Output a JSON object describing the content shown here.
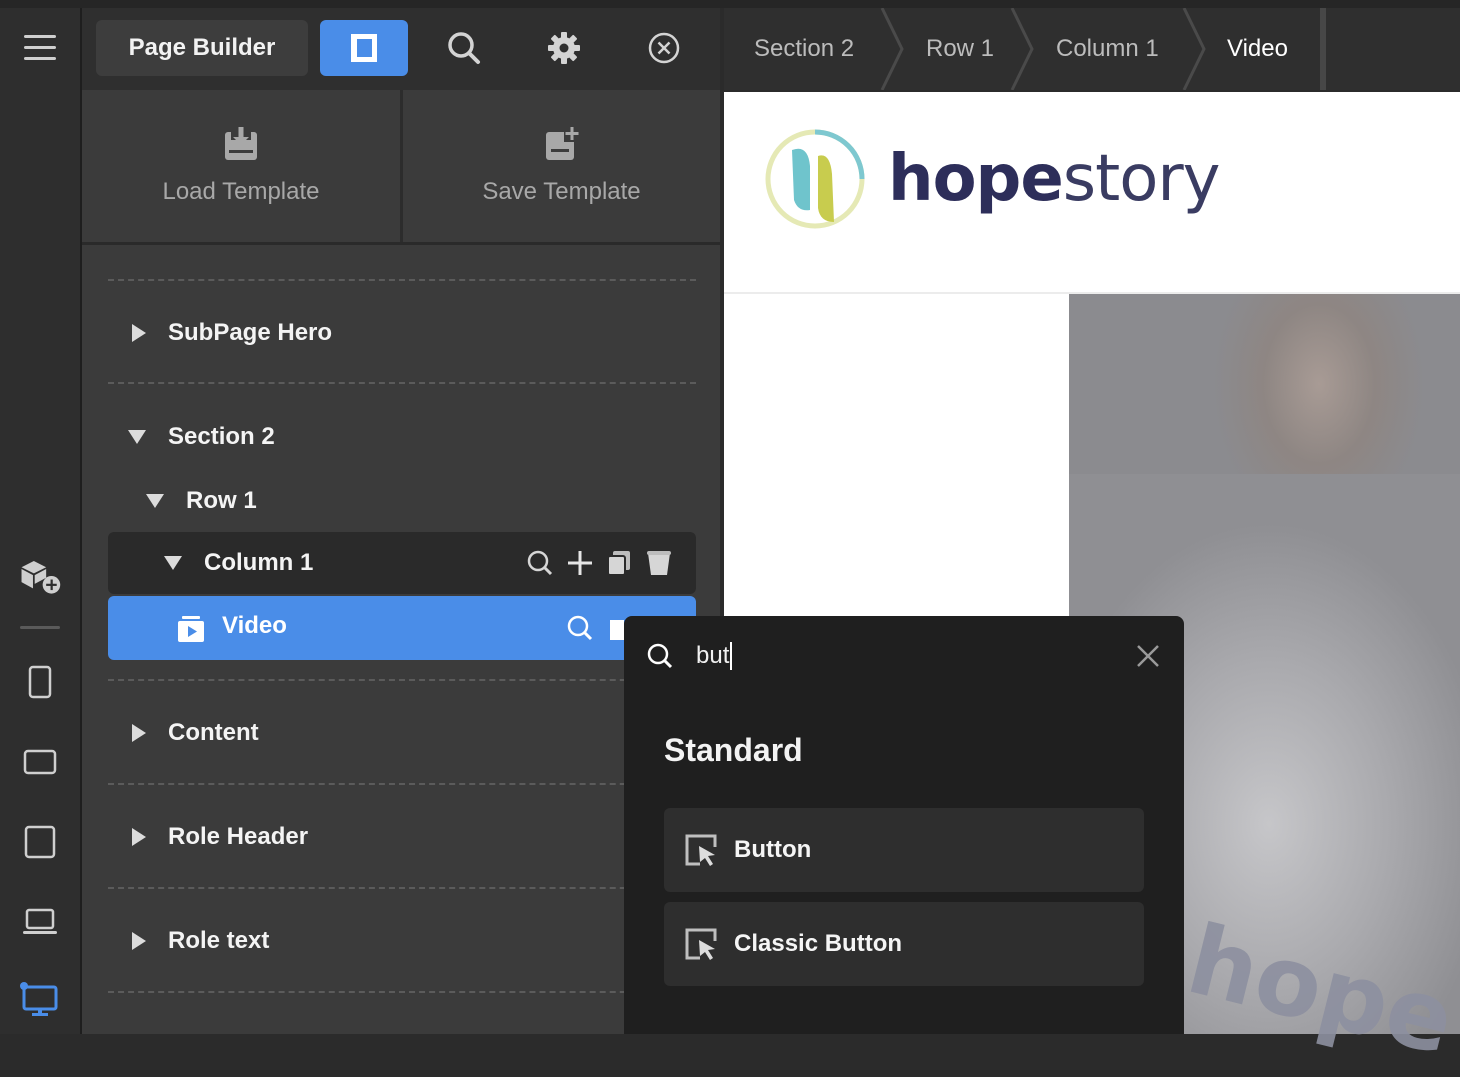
{
  "toolbar": {
    "title": "Page Builder"
  },
  "breadcrumb": [
    "Section 2",
    "Row 1",
    "Column 1",
    "Video"
  ],
  "templates": {
    "load_label": "Load Template",
    "save_label": "Save Template"
  },
  "tree": {
    "items": [
      {
        "label": "SubPage Hero",
        "expanded": false
      },
      {
        "label": "Section 2",
        "expanded": true
      },
      {
        "label": "Row 1",
        "expanded": true
      },
      {
        "label": "Column 1",
        "expanded": true
      },
      {
        "label": "Video",
        "selected": true
      },
      {
        "label": "Content",
        "expanded": false
      },
      {
        "label": "Role Header",
        "expanded": false
      },
      {
        "label": "Role text",
        "expanded": false
      }
    ]
  },
  "preview": {
    "logo_bold": "hope",
    "logo_light": "story",
    "photo_text": "hope"
  },
  "search": {
    "value": "but",
    "section_heading": "Standard",
    "results": [
      "Button",
      "Classic Button"
    ]
  },
  "colors": {
    "accent": "#4a8de8",
    "panel": "#3b3b3b",
    "toolbar": "#2f2f2f",
    "popover": "#1f1f1f"
  },
  "icons": {
    "rail": [
      "menu-icon",
      "add-module-icon",
      "phone-icon",
      "tablet-landscape-icon",
      "tablet-icon",
      "laptop-icon",
      "desktop-icon"
    ],
    "toolbar": [
      "layout-panel-icon",
      "search-icon",
      "gear-icon",
      "close-circle-icon"
    ]
  }
}
